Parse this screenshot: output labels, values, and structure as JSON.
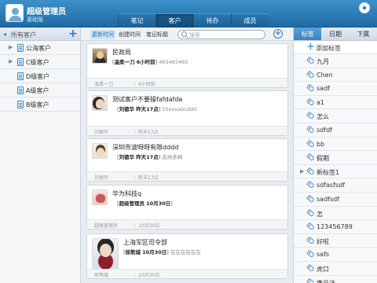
{
  "header": {
    "username": "超级管理员",
    "edition": "基础版",
    "tabs": [
      {
        "label": "笔记"
      },
      {
        "label": "客户",
        "active": true
      },
      {
        "label": "待办"
      },
      {
        "label": "成员"
      }
    ]
  },
  "left": {
    "title": "所有客户",
    "groups": [
      {
        "label": "公海客户",
        "expandable": true
      },
      {
        "label": "C级客户",
        "expandable": true
      },
      {
        "label": "D级客户"
      },
      {
        "label": "A级客户"
      },
      {
        "label": "B级客户"
      }
    ]
  },
  "middle": {
    "sort_options": [
      "更新时间",
      "创建时间",
      "笔记标题"
    ],
    "search_placeholder": "搜索",
    "cards": [
      {
        "name": "民政局",
        "author": "温柔一刀",
        "ago": "6小时前",
        "phone": "465465465",
        "footer_left": "温柔一刀",
        "footer_right": "6小时前"
      },
      {
        "name": "测试客户不要操fafdafda",
        "author": "刘德华",
        "when": "昨天17点",
        "note": "55xxxabcddd",
        "footer_left": "刘德华",
        "footer_right": "昨天17点"
      },
      {
        "name": "深圳市波呀呀有限dddd",
        "author": "刘德华",
        "when": "昨天17点",
        "note": "支持多网",
        "footer_left": "刘德华",
        "footer_right": "昨天17点"
      },
      {
        "name": "华为科技q",
        "author": "超级管理员",
        "when": "10月30日",
        "note": "",
        "footer_left": "超级管理员",
        "footer_right": "10月30日"
      },
      {
        "name": "上海军区司令部",
        "author": "徐熊城",
        "when": "10月30日",
        "note": "在在在在在在",
        "footer_left": "徐熊城",
        "footer_right": "10月30日"
      }
    ]
  },
  "right": {
    "tabs": [
      {
        "label": "标签",
        "active": true
      },
      {
        "label": "日期"
      },
      {
        "label": "下属"
      }
    ],
    "add_tag_label": "添加标签",
    "tags": [
      {
        "label": "九月"
      },
      {
        "label": "Chen"
      },
      {
        "label": "sadf"
      },
      {
        "label": "a1"
      },
      {
        "label": "怎么"
      },
      {
        "label": "sdfdf"
      },
      {
        "label": "bb"
      },
      {
        "label": "假期"
      },
      {
        "label": "新标签1",
        "expandable": true
      },
      {
        "label": "sdfasfsdf"
      },
      {
        "label": "sadfsdf"
      },
      {
        "label": "怎"
      },
      {
        "label": "123456789"
      },
      {
        "label": "好啦"
      },
      {
        "label": "safs"
      },
      {
        "label": "虎口"
      },
      {
        "label": "撒旦法"
      }
    ]
  },
  "colors": {
    "header_blue": "#2a78b2",
    "accent": "#2b7bc0"
  }
}
